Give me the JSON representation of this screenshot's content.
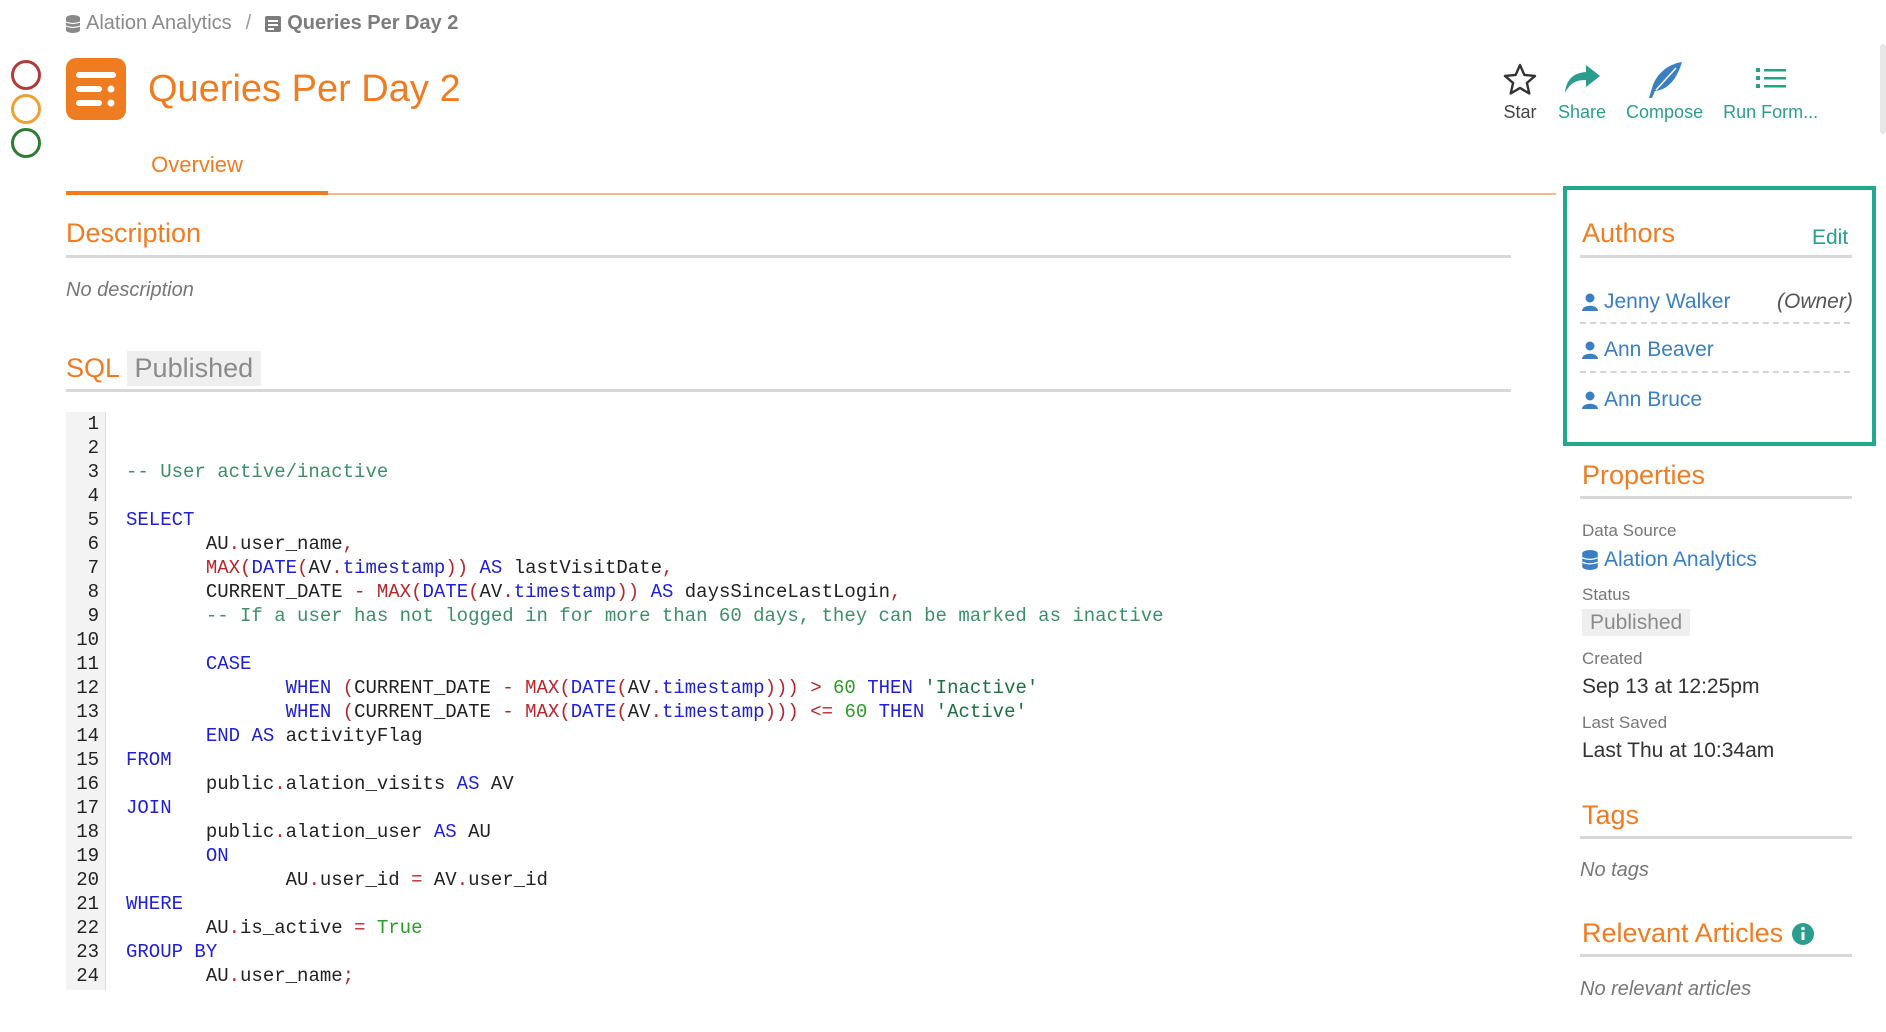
{
  "breadcrumb": {
    "source": "Alation Analytics",
    "separator": "/",
    "current": "Queries Per Day 2"
  },
  "page": {
    "title": "Queries Per Day 2"
  },
  "actions": {
    "star": "Star",
    "share": "Share",
    "compose": "Compose",
    "run": "Run Form..."
  },
  "tabs": {
    "overview": "Overview"
  },
  "description": {
    "heading": "Description",
    "empty": "No description"
  },
  "sql": {
    "heading": "SQL",
    "status": "Published",
    "line_numbers": [
      "1",
      "2",
      "3",
      "4",
      "5",
      "6",
      "7",
      "8",
      "9",
      "10",
      "11",
      "12",
      "13",
      "14",
      "15",
      "16",
      "17",
      "18",
      "19",
      "20",
      "21",
      "22",
      "23",
      "24"
    ]
  },
  "authors": {
    "heading": "Authors",
    "edit": "Edit",
    "items": [
      {
        "name": "Jenny Walker",
        "role": "(Owner)"
      },
      {
        "name": "Ann Beaver"
      },
      {
        "name": "Ann Bruce"
      }
    ]
  },
  "properties": {
    "heading": "Properties",
    "data_source_label": "Data Source",
    "data_source": "Alation Analytics",
    "status_label": "Status",
    "status": "Published",
    "created_label": "Created",
    "created": "Sep 13 at 12:25pm",
    "last_saved_label": "Last Saved",
    "last_saved": "Last Thu at 10:34am"
  },
  "tags": {
    "heading": "Tags",
    "empty": "No tags"
  },
  "articles": {
    "heading": "Relevant Articles",
    "empty": "No relevant articles"
  },
  "colors": {
    "accent": "#f07c22",
    "link": "#3a7fc4",
    "teal": "#22a88e",
    "circle_red": "#b23a3a",
    "circle_amber": "#f0a030",
    "circle_green": "#2e7d32"
  }
}
